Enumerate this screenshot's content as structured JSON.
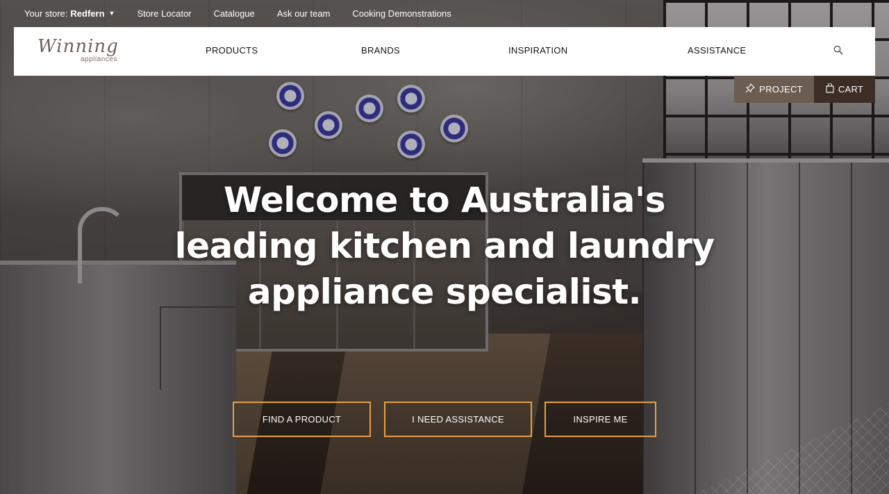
{
  "topbar": {
    "store_prefix": "Your store:",
    "store_name": "Redfern",
    "links": [
      "Store Locator",
      "Catalogue",
      "Ask our team",
      "Cooking Demonstrations"
    ]
  },
  "logo": {
    "word": "Winning",
    "sub": "appliances"
  },
  "nav": {
    "items": [
      "PRODUCTS",
      "BRANDS",
      "INSPIRATION",
      "ASSISTANCE"
    ],
    "search_icon": "search-icon"
  },
  "actions": {
    "project_label": "PROJECT",
    "project_icon": "pin-icon",
    "cart_label": "CART",
    "cart_icon": "bag-icon"
  },
  "hero": {
    "headline_lines": [
      "Welcome to Australia's",
      "leading kitchen and laundry",
      "appliance specialist."
    ],
    "cta": [
      "FIND A PRODUCT",
      "I NEED ASSISTANCE",
      "INSPIRE ME"
    ]
  },
  "colors": {
    "nav_bg": "#ffffff",
    "project_bg": "#6c5d52",
    "cart_bg": "#3c2e26",
    "cta_border": "#e4a04e",
    "logo": "#6e625a"
  }
}
